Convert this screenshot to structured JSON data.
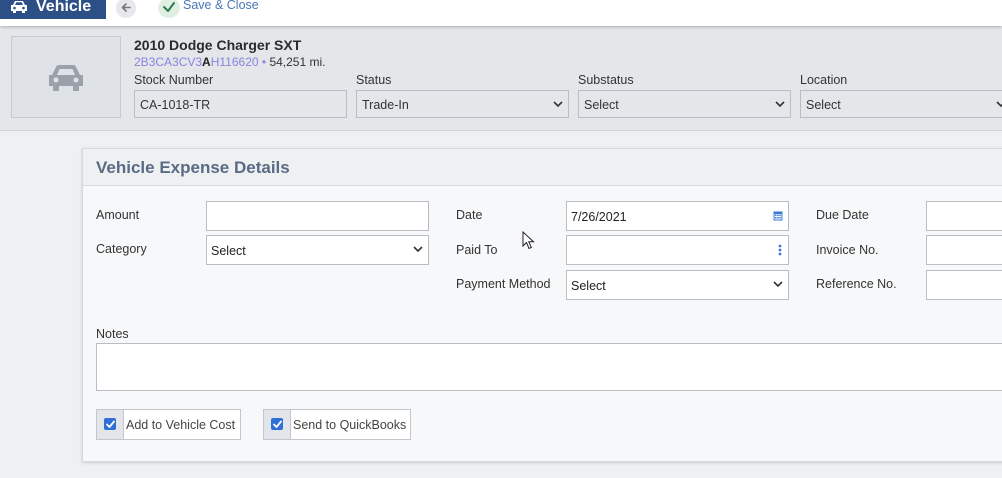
{
  "topbar": {
    "title": "Vehicle",
    "save_label": "Save & Close"
  },
  "vehicle": {
    "title": "2010 Dodge Charger SXT",
    "vin_prefix": "2B3CA3CV3",
    "vin_highlight": "A",
    "vin_suffix": "H116620",
    "mileage": "54,251 mi."
  },
  "header_fields": {
    "stock_label": "Stock Number",
    "stock_value": "CA-1018-TR",
    "status_label": "Status",
    "status_value": "Trade-In",
    "substatus_label": "Substatus",
    "substatus_value": "Select",
    "location_label": "Location",
    "location_value": "Select"
  },
  "form": {
    "title": "Vehicle Expense Details",
    "amount_label": "Amount",
    "amount_value": "",
    "category_label": "Category",
    "category_value": "Select",
    "date_label": "Date",
    "date_value": "7/26/2021",
    "paid_to_label": "Paid To",
    "paid_to_value": "",
    "payment_method_label": "Payment Method",
    "payment_method_value": "Select",
    "due_date_label": "Due Date",
    "due_date_value": "",
    "invoice_label": "Invoice No.",
    "invoice_value": "",
    "reference_label": "Reference No.",
    "reference_value": "",
    "notes_label": "Notes",
    "notes_value": "",
    "add_cost_label": "Add to Vehicle Cost",
    "add_cost_checked": true,
    "quickbooks_label": "Send to QuickBooks",
    "quickbooks_checked": true
  },
  "icons": {
    "vehicle_tab": "car-icon",
    "back": "arrow-left-icon",
    "save": "checkmark-icon",
    "thumbnail": "car-icon",
    "date": "calendar-icon",
    "paid_to": "kebab-menu-icon",
    "dropdown": "chevron-down-icon"
  },
  "colors": {
    "brand": "#2c4f85",
    "link": "#4a78b8",
    "checkbox": "#2f6fd6",
    "vin": "#8a82e0",
    "card_title": "#5a6b85"
  }
}
